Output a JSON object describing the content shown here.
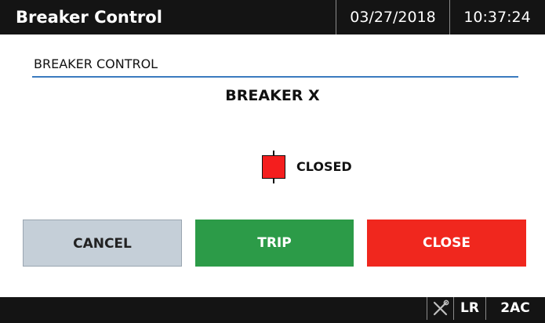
{
  "header": {
    "title": "Breaker Control",
    "date": "03/27/2018",
    "time": "10:37:24"
  },
  "panel": {
    "section_label": "BREAKER CONTROL",
    "breaker_name": "BREAKER X",
    "status": "CLOSED",
    "status_color": "#f41e1e"
  },
  "buttons": {
    "cancel": "CANCEL",
    "trip": "TRIP",
    "close": "CLOSE"
  },
  "footer": {
    "tool_icon": "wrench-screwdriver-icon",
    "mode": "LR",
    "indicator": "2AC"
  }
}
